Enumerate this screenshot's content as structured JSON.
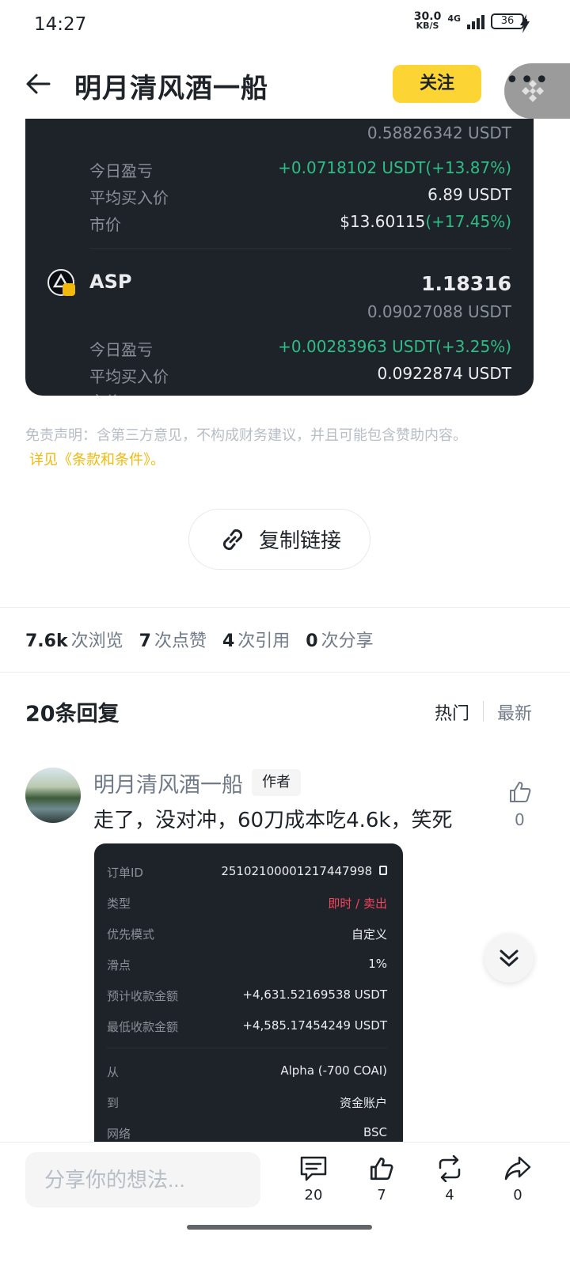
{
  "status_bar": {
    "time": "14:27",
    "net_speed_value": "30.0",
    "net_speed_unit": "KB/S",
    "network": "4G",
    "battery": "36"
  },
  "header": {
    "title": "明月清风酒一船",
    "follow_label": "关注",
    "more_label": "•••"
  },
  "holdings": {
    "first": {
      "amount_usdt": "0.58826342 USDT",
      "today_pnl_label": "今日盈亏",
      "today_pnl_value": "+0.0718102 USDT(+13.87%)",
      "avg_price_label": "平均买入价",
      "avg_price_value": "6.89 USDT",
      "market_label": "市价",
      "market_price": "$13.60115",
      "market_change": "(+17.45%)"
    },
    "second": {
      "symbol": "ASP",
      "amount": "1.18316",
      "amount_usdt": "0.09027088 USDT",
      "today_pnl_label": "今日盈亏",
      "today_pnl_value": "+0.00283963 USDT(+3.25%)",
      "avg_price_label": "平均买入价",
      "avg_price_value": "0.0922874 USDT",
      "market_label": "市价"
    }
  },
  "disclaimer": {
    "text": "免责声明：含第三方意见，不构成财务建议，并且可能包含赞助内容。",
    "link": "详见《条款和条件》。"
  },
  "copy_link_label": "复制链接",
  "stats": [
    {
      "num": "7.6k",
      "label": "次浏览"
    },
    {
      "num": "7",
      "label": "次点赞"
    },
    {
      "num": "4",
      "label": "次引用"
    },
    {
      "num": "0",
      "label": "次分享"
    }
  ],
  "replies": {
    "title": "20条回复",
    "sort_hot": "热门",
    "sort_new": "最新"
  },
  "comment": {
    "user": "明月清风酒一船",
    "badge": "作者",
    "text": "走了，没对冲，60刀成本吃4.6k，笑死",
    "likes": "0",
    "order": {
      "order_id_label": "订单ID",
      "order_id": "25102100001217447998",
      "type_label": "类型",
      "type_value": "即时 / 卖出",
      "priority_label": "优先模式",
      "priority_value": "自定义",
      "slippage_label": "滑点",
      "slippage_value": "1%",
      "expected_label": "预计收款金额",
      "expected_value": "+4,631.52169538 USDT",
      "min_label": "最低收款金额",
      "min_value": "+4,585.17454249 USDT",
      "from_label": "从",
      "from_value": "Alpha (-700 COAI)",
      "to_label": "到",
      "to_value": "资金账户",
      "network_label": "网络",
      "network_value": "BSC"
    }
  },
  "bottom_bar": {
    "input_placeholder": "分享你的想法...",
    "comments": "20",
    "likes": "7",
    "reposts": "4",
    "shares": "0"
  },
  "colors": {
    "brand_yellow": "#fcd535",
    "positive": "#2ebd85",
    "negative": "#f6465d",
    "card_dark": "#1e2329"
  }
}
